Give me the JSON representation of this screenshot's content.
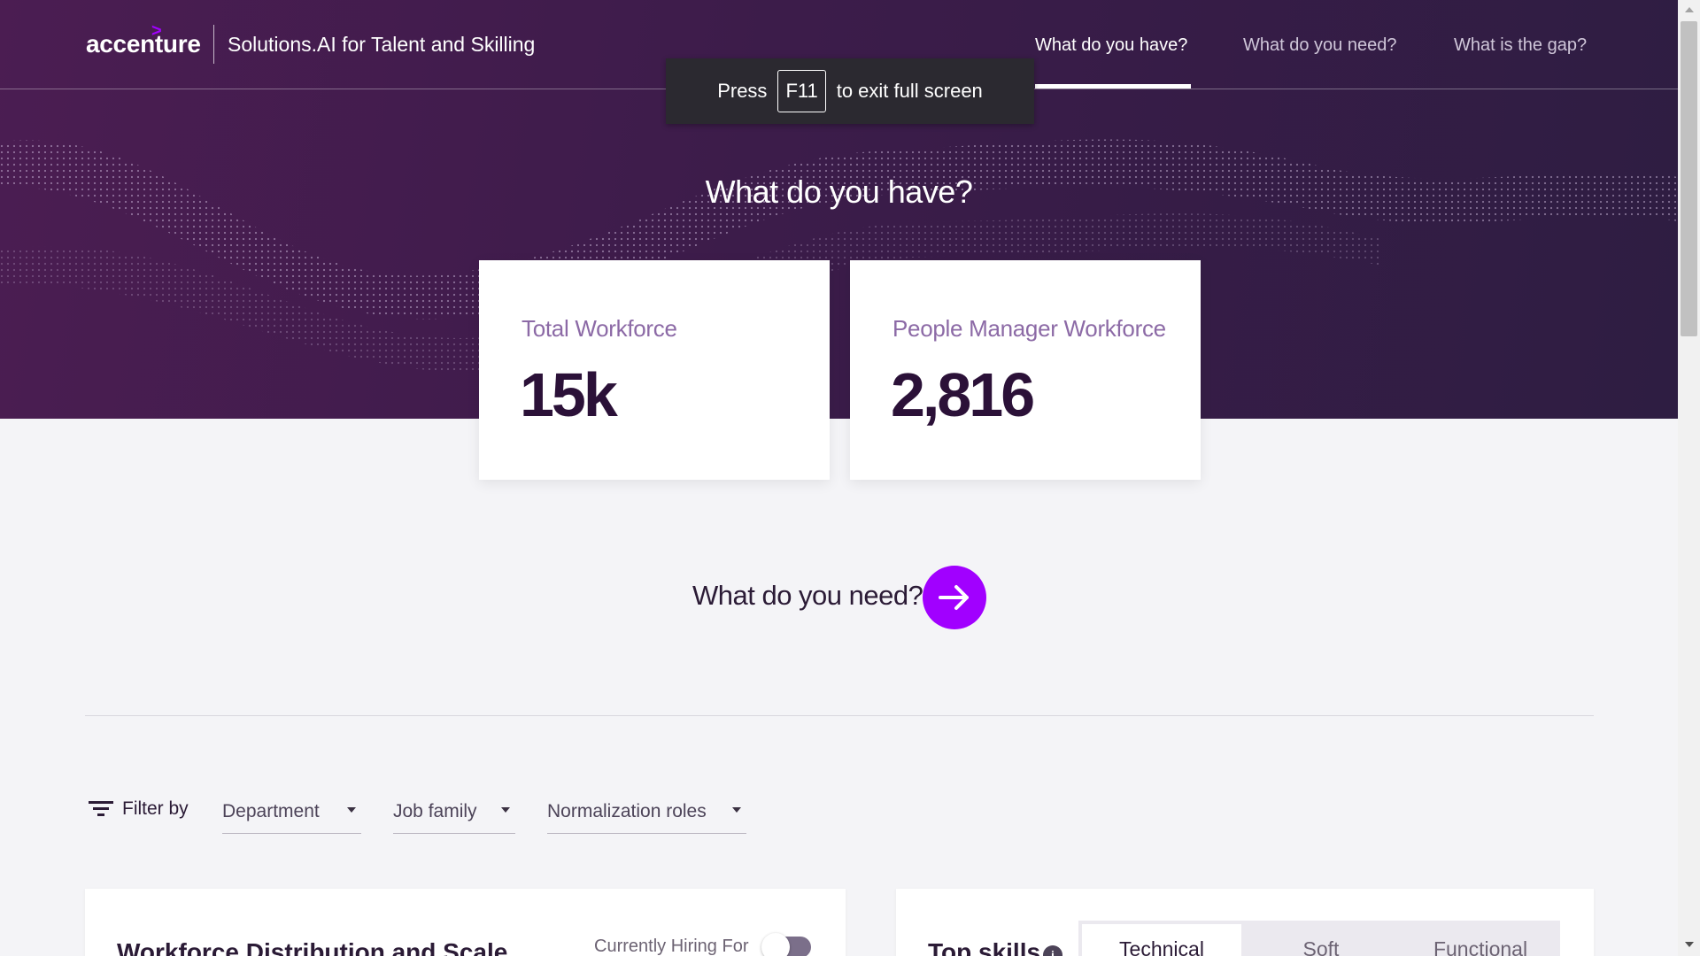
{
  "header": {
    "logo_text": "accenture",
    "app_title": "Solutions.AI for Talent and Skilling",
    "nav": [
      {
        "label": "What do you have?",
        "active": true
      },
      {
        "label": "What do you need?",
        "active": false
      },
      {
        "label": "What is the gap?",
        "active": false
      }
    ]
  },
  "fullscreen_toast": {
    "press": "Press",
    "key": "F11",
    "suffix": "to exit full screen"
  },
  "hero": {
    "heading": "What do you have?"
  },
  "cards": [
    {
      "label": "Total Workforce",
      "value": "15k"
    },
    {
      "label": "People Manager Workforce",
      "value": "2,816"
    }
  ],
  "next_step": {
    "label": "What do you need?",
    "icon": "arrow-right-icon"
  },
  "filters": {
    "label": "Filter by",
    "dropdowns": [
      {
        "label": "Department"
      },
      {
        "label": "Job family"
      },
      {
        "label": "Normalization roles"
      }
    ]
  },
  "panels": {
    "distribution": {
      "title": "Workforce Distribution and Scale",
      "toggle_label": "Currently Hiring For",
      "toggle_on": false
    },
    "top_skills": {
      "title": "Top skills",
      "tabs": [
        {
          "label": "Technical",
          "active": true
        },
        {
          "label": "Soft",
          "active": false
        },
        {
          "label": "Functional",
          "active": false
        }
      ]
    }
  },
  "colors": {
    "accent": "#a100ff",
    "hero_dark": "#3c1c4a",
    "value_text": "#2b1138"
  }
}
